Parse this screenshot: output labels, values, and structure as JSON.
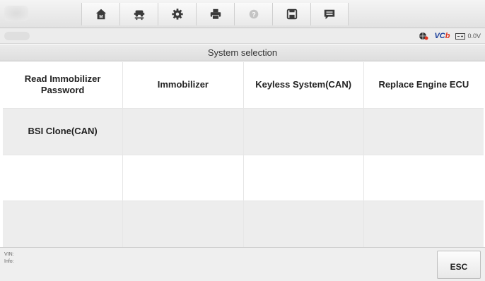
{
  "toolbar": {
    "icons": [
      "home-icon",
      "vehicle-lift-icon",
      "gear-icon",
      "printer-icon",
      "help-icon",
      "save-icon",
      "message-icon"
    ]
  },
  "status": {
    "vci_label_a": "VC",
    "vci_label_b": "b",
    "voltage": "0.0V"
  },
  "title": "System selection",
  "grid": {
    "cells": [
      "Read Immobilizer Password",
      "Immobilizer",
      "Keyless System(CAN)",
      "Replace Engine ECU",
      "BSI Clone(CAN)",
      "",
      "",
      "",
      "",
      "",
      "",
      "",
      "",
      "",
      "",
      ""
    ]
  },
  "footer": {
    "vin_label": "VIN:",
    "info_label": "Info:",
    "esc_label": "ESC"
  },
  "colors": {
    "vci_blue": "#1a3e9a",
    "vci_red": "#e0341f",
    "cell_light": "#ffffff",
    "cell_dark": "#ededed"
  }
}
